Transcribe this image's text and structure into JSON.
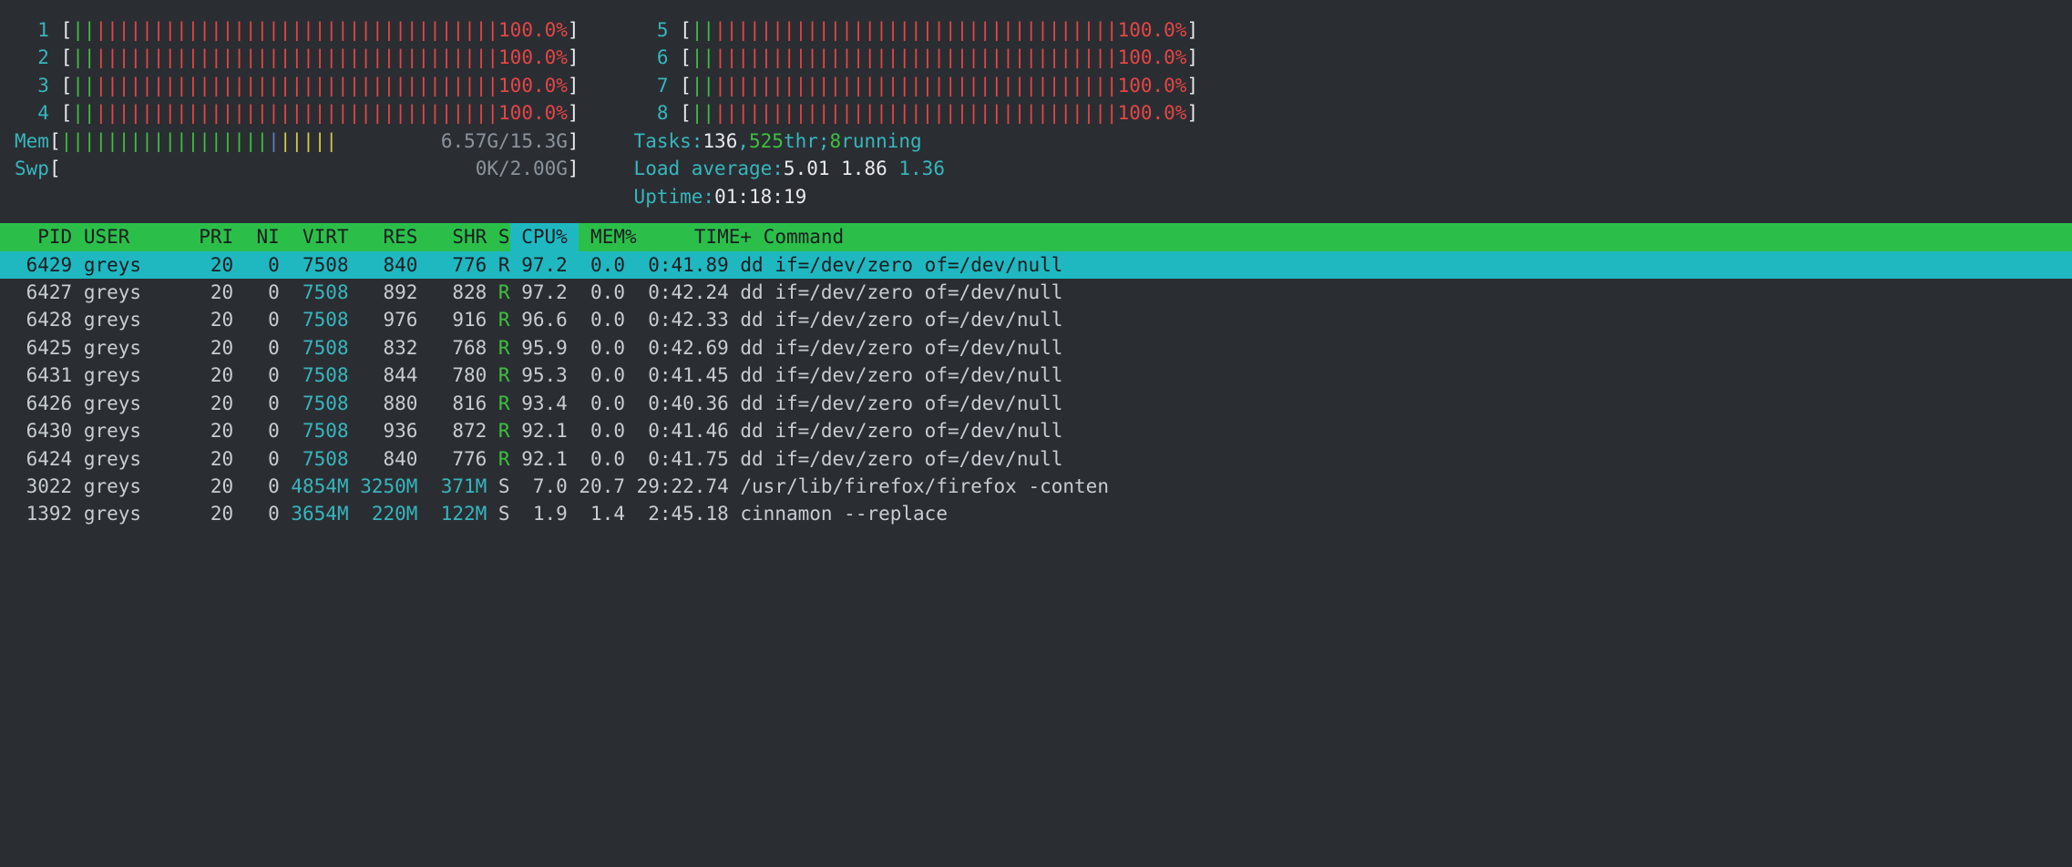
{
  "cpus_left": [
    {
      "id": "1",
      "bar_g": "||",
      "bar_r": "|||||||||||||||||||||||||||||||||||",
      "pct": "100.0%"
    },
    {
      "id": "2",
      "bar_g": "||",
      "bar_r": "|||||||||||||||||||||||||||||||||||",
      "pct": "100.0%"
    },
    {
      "id": "3",
      "bar_g": "||",
      "bar_r": "|||||||||||||||||||||||||||||||||||",
      "pct": "100.0%"
    },
    {
      "id": "4",
      "bar_g": "||",
      "bar_r": "|||||||||||||||||||||||||||||||||||",
      "pct": "100.0%"
    }
  ],
  "cpus_right": [
    {
      "id": "5",
      "bar_g": "||",
      "bar_r": "|||||||||||||||||||||||||||||||||||",
      "pct": "100.0%"
    },
    {
      "id": "6",
      "bar_g": "||",
      "bar_r": "|||||||||||||||||||||||||||||||||||",
      "pct": "100.0%"
    },
    {
      "id": "7",
      "bar_g": "||",
      "bar_r": "|||||||||||||||||||||||||||||||||||",
      "pct": "100.0%"
    },
    {
      "id": "8",
      "bar_g": "||",
      "bar_r": "|||||||||||||||||||||||||||||||||||",
      "pct": "100.0%"
    }
  ],
  "mem": {
    "label": "Mem",
    "bar_g": "||||||||||||||||||",
    "bar_b": "|",
    "bar_y": "|||||",
    "text": "6.57G/15.3G"
  },
  "swp": {
    "label": "Swp",
    "text": "0K/2.00G"
  },
  "tasks": {
    "label": "Tasks: ",
    "count": "136",
    "sep": ", ",
    "threads": "525",
    "thr_label": " thr; ",
    "running": "8",
    "running_label": " running"
  },
  "load": {
    "label": "Load average: ",
    "v1": "5.01",
    "v2": "1.86",
    "v3": "1.36"
  },
  "uptime": {
    "label": "Uptime: ",
    "value": "01:18:19"
  },
  "headers": {
    "pid": "PID",
    "user": "USER",
    "pri": "PRI",
    "ni": "NI",
    "virt": "VIRT",
    "res": "RES",
    "shr": "SHR",
    "s": "S",
    "cpu": "CPU% ",
    "mem": "MEM%",
    "time": "TIME+",
    "cmd": "Command"
  },
  "processes": [
    {
      "pid": "6429",
      "user": "greys",
      "pri": "20",
      "ni": "0",
      "virt": "7508",
      "res": "840",
      "shr": "776",
      "s": "R",
      "cpu": "97.2",
      "mem": "0.0",
      "time": "0:41.89",
      "cmd": "dd if=/dev/zero of=/dev/null",
      "sel": true,
      "virt_cyan": false
    },
    {
      "pid": "6427",
      "user": "greys",
      "pri": "20",
      "ni": "0",
      "virt": "7508",
      "res": "892",
      "shr": "828",
      "s": "R",
      "cpu": "97.2",
      "mem": "0.0",
      "time": "0:42.24",
      "cmd": "dd if=/dev/zero of=/dev/null",
      "virt_cyan": true
    },
    {
      "pid": "6428",
      "user": "greys",
      "pri": "20",
      "ni": "0",
      "virt": "7508",
      "res": "976",
      "shr": "916",
      "s": "R",
      "cpu": "96.6",
      "mem": "0.0",
      "time": "0:42.33",
      "cmd": "dd if=/dev/zero of=/dev/null",
      "virt_cyan": true
    },
    {
      "pid": "6425",
      "user": "greys",
      "pri": "20",
      "ni": "0",
      "virt": "7508",
      "res": "832",
      "shr": "768",
      "s": "R",
      "cpu": "95.9",
      "mem": "0.0",
      "time": "0:42.69",
      "cmd": "dd if=/dev/zero of=/dev/null",
      "virt_cyan": true
    },
    {
      "pid": "6431",
      "user": "greys",
      "pri": "20",
      "ni": "0",
      "virt": "7508",
      "res": "844",
      "shr": "780",
      "s": "R",
      "cpu": "95.3",
      "mem": "0.0",
      "time": "0:41.45",
      "cmd": "dd if=/dev/zero of=/dev/null",
      "virt_cyan": true
    },
    {
      "pid": "6426",
      "user": "greys",
      "pri": "20",
      "ni": "0",
      "virt": "7508",
      "res": "880",
      "shr": "816",
      "s": "R",
      "cpu": "93.4",
      "mem": "0.0",
      "time": "0:40.36",
      "cmd": "dd if=/dev/zero of=/dev/null",
      "virt_cyan": true
    },
    {
      "pid": "6430",
      "user": "greys",
      "pri": "20",
      "ni": "0",
      "virt": "7508",
      "res": "936",
      "shr": "872",
      "s": "R",
      "cpu": "92.1",
      "mem": "0.0",
      "time": "0:41.46",
      "cmd": "dd if=/dev/zero of=/dev/null",
      "virt_cyan": true
    },
    {
      "pid": "6424",
      "user": "greys",
      "pri": "20",
      "ni": "0",
      "virt": "7508",
      "res": "840",
      "shr": "776",
      "s": "R",
      "cpu": "92.1",
      "mem": "0.0",
      "time": "0:41.75",
      "cmd": "dd if=/dev/zero of=/dev/null",
      "virt_cyan": true
    },
    {
      "pid": "3022",
      "user": "greys",
      "pri": "20",
      "ni": "0",
      "virt": "4854M",
      "res": "3250M",
      "shr": "371M",
      "s": "S",
      "cpu": "7.0",
      "mem": "20.7",
      "time": "29:22.74",
      "cmd": "/usr/lib/firefox/firefox -conten",
      "virt_cyan": true,
      "res_cyan": true,
      "shr_cyan": true
    },
    {
      "pid": "1392",
      "user": "greys",
      "pri": "20",
      "ni": "0",
      "virt": "3654M",
      "res": "220M",
      "shr": "122M",
      "s": "S",
      "cpu": "1.9",
      "mem": "1.4",
      "time": "2:45.18",
      "cmd": "cinnamon --replace",
      "virt_cyan": true,
      "res_cyan": true,
      "shr_cyan": true
    }
  ]
}
